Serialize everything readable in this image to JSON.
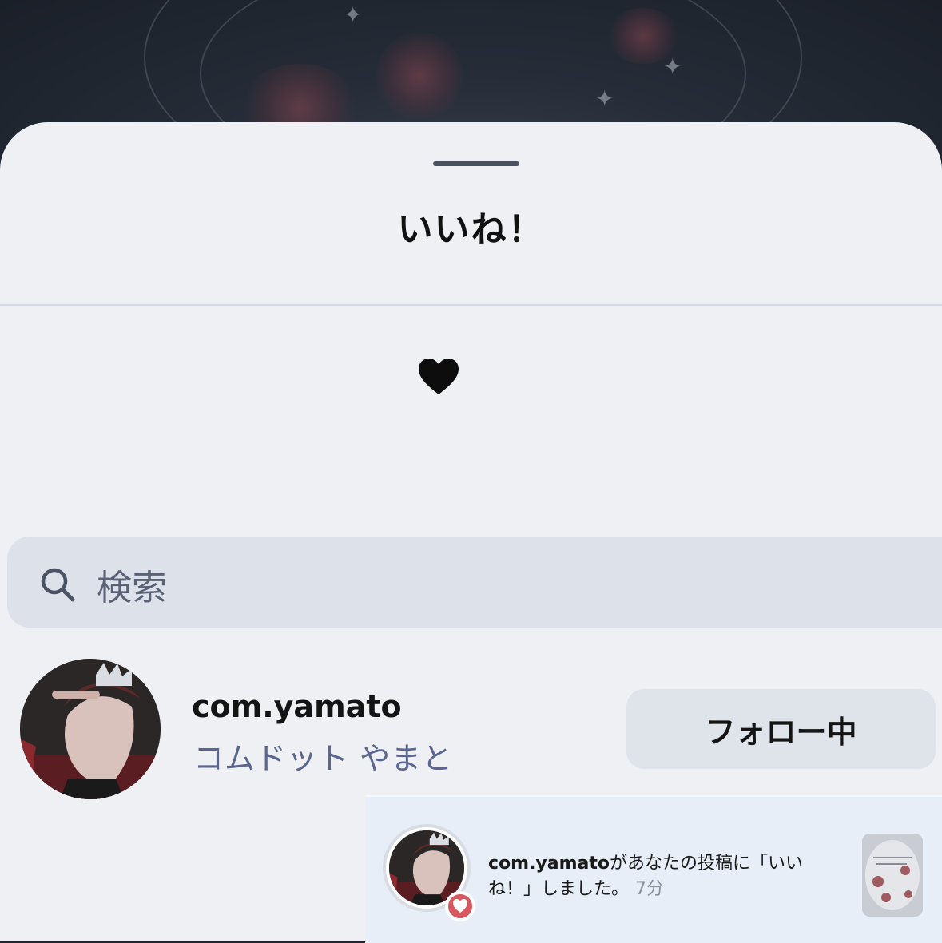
{
  "sheet": {
    "title": "いいね！"
  },
  "search": {
    "placeholder": "検索"
  },
  "user": {
    "username": "com.yamato",
    "display_name": "コムドット やまと",
    "follow_button_label": "フォロー中"
  },
  "notification": {
    "username": "com.yamato",
    "message": "があなたの投稿に「いいね！」しました。",
    "time": "7分"
  },
  "icons": {
    "heart": "heart-icon",
    "search": "search-icon"
  },
  "colors": {
    "sheet_bg": "#eef0f4",
    "search_bg": "#dde1ea",
    "display_name": "#5a6690",
    "badge_red": "#d9585f"
  }
}
